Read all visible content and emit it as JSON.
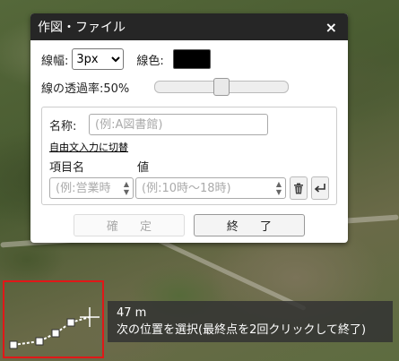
{
  "dialog": {
    "title": "作図・ファイル",
    "close_label": "×",
    "line_width_label": "線幅:",
    "line_width_value": "3px",
    "line_width_options": [
      "3px"
    ],
    "line_color_label": "線色:",
    "line_color": "#000000",
    "transparency_label": "線の透過率:50%",
    "transparency_value": 0.5,
    "name_label": "名称:",
    "name_placeholder": "(例:A図書館)",
    "free_text_link": "自由文入力に切替",
    "item_header": "項目名",
    "value_header": "値",
    "item_placeholder": "(例:営業時",
    "value_placeholder": "(例:10時～18時)",
    "confirm_label": "確 定",
    "finish_label": "終 了"
  },
  "tooltip": {
    "distance": "47 m",
    "instruction": "次の位置を選択(最終点を2回クリックして終了)"
  },
  "colors": {
    "selection_box": "#e01818",
    "titlebar": "#262626"
  }
}
